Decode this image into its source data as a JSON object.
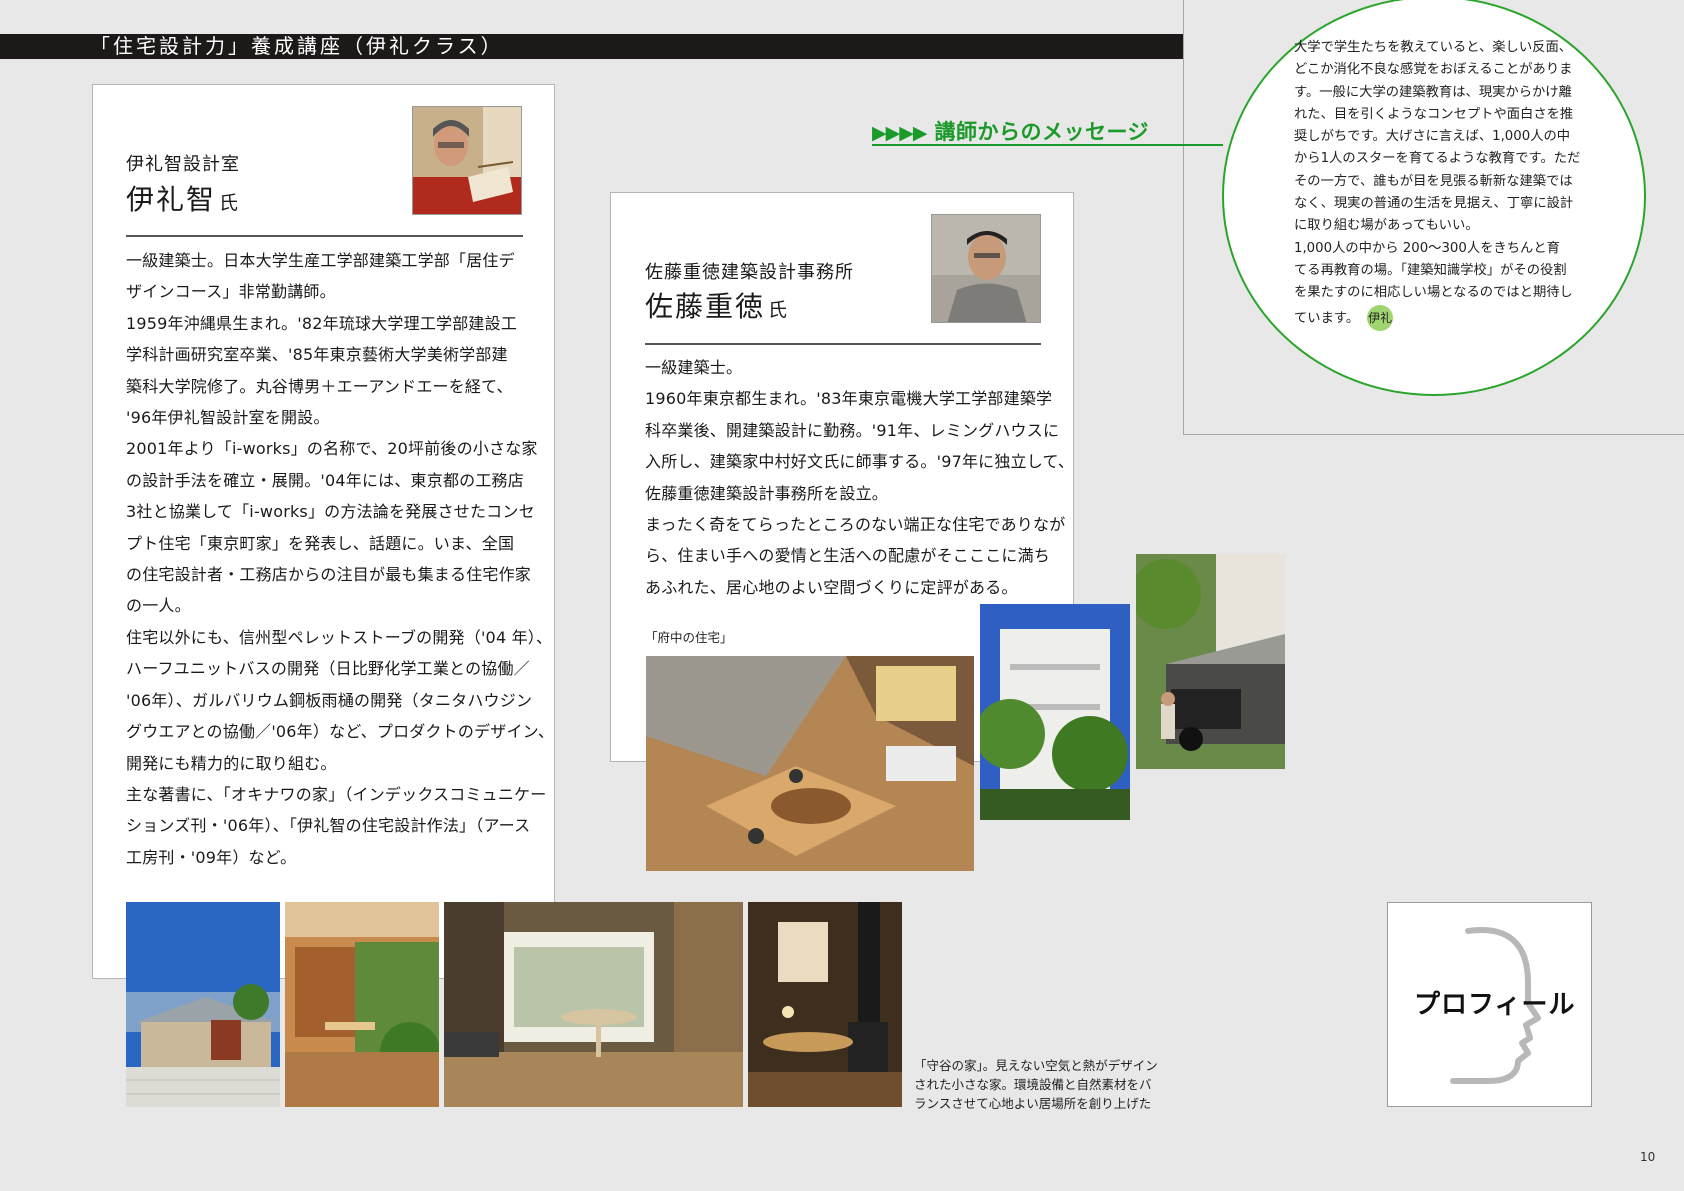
{
  "header": {
    "title": "「住宅設計力」養成講座（伊礼クラス）"
  },
  "instructor_1": {
    "office": "伊礼智設計室",
    "name": "伊礼智",
    "honorific": "氏",
    "bio_lines": [
      "一級建築士。日本大学生産工学部建築工学部「居住デ",
      "ザインコース」非常勤講師。",
      "1959年沖縄県生まれ。'82年琉球大学理工学部建設工",
      "学科計画研究室卒業、'85年東京藝術大学美術学部建",
      "築科大学院修了。丸谷博男＋エーアンドエーを経て、",
      "'96年伊礼智設計室を開設。",
      "2001年より「i-works」の名称で、20坪前後の小さな家",
      "の設計手法を確立・展開。'04年には、東京都の工務店",
      "3社と協業して「i-works」の方法論を発展させたコンセ",
      "プト住宅「東京町家」を発表し、話題に。いま、全国",
      "の住宅設計者・工務店からの注目が最も集まる住宅作家",
      "の一人。",
      "住宅以外にも、信州型ペレットストーブの開発（'04 年）、",
      "ハーフユニットバスの開発（日比野化学工業との協働／",
      "'06年）、ガルバリウム鋼板雨樋の開発（タニタハウジン",
      "グウエアとの協働／'06年）など、プロダクトのデザイン、",
      "開発にも精力的に取り組む。",
      "主な著書に、「オキナワの家」（インデックスコミュニケー",
      "ションズ刊・'06年）、「伊礼智の住宅設計作法」（アース",
      "工房刊・'09年）など。"
    ],
    "photo_caption_lines": [
      "「守谷の家」。見えない空気と熱がデザイン",
      "された小さな家。環境設備と自然素材をバ",
      "ランスさせて心地よい居場所を創り上げた"
    ]
  },
  "instructor_2": {
    "office": "佐藤重徳建築設計事務所",
    "name": "佐藤重徳",
    "honorific": "氏",
    "bio_lines": [
      "一級建築士。",
      "1960年東京都生まれ。'83年東京電機大学工学部建築学",
      "科卒業後、開建築設計に勤務。'91年、レミングハウスに",
      "入所し、建築家中村好文氏に師事する。'97年に独立して、",
      "佐藤重徳建築設計事務所を設立。",
      "まったく奇をてらったところのない端正な住宅でありなが",
      "ら、住まい手への愛情と生活への配慮がそこここに満ち",
      "あふれた、居心地のよい空間づくりに定評がある。"
    ],
    "photo_caption": "「府中の住宅」"
  },
  "message": {
    "heading": "講師からのメッセージ",
    "arrows": "▶▶▶▶",
    "lines": [
      "大学で学生たちを教えていると、楽しい反面、",
      "どこか消化不良な感覚をおぼえることがありま",
      "す。一般に大学の建築教育は、現実からかけ離",
      "れた、目を引くようなコンセプトや面白さを推",
      "奨しがちです。大げさに言えば、1,000人の中",
      "から1人のスターを育てるような教育です。ただ",
      "その一方で、誰もが目を見張る斬新な建築では",
      "なく、現実の普通の生活を見据え、丁寧に設計",
      "に取り組む場があってもいい。",
      "1,000人の中から 200～300人をきちんと育",
      "てる再教育の場。「建築知識学校」がその役割",
      "を果たすのに相応しい場となるのではと期待し"
    ],
    "last_line": "ています。",
    "signature": "伊礼"
  },
  "profile_label": "プロフィール",
  "page_number": "10",
  "colors": {
    "accent_green": "#1b9a2a",
    "header_band": "#1d1918",
    "page_background": "#e7e8e7"
  }
}
